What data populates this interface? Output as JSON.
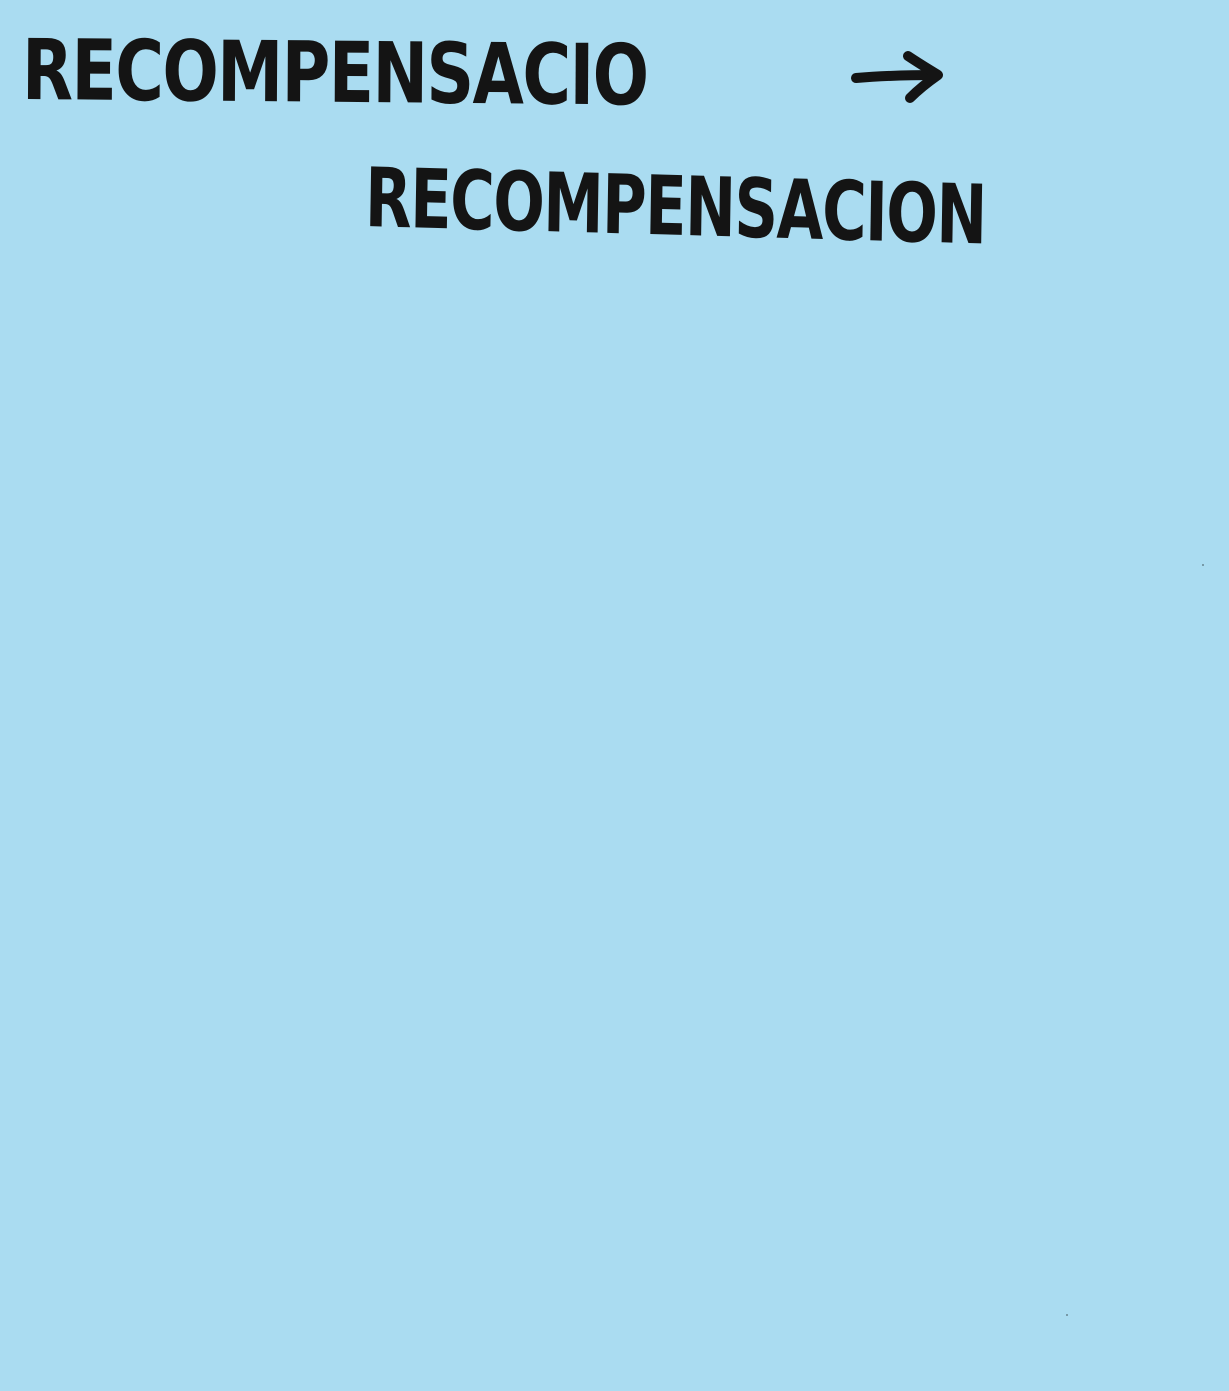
{
  "note": {
    "background_color": "#aadcf1",
    "ink_color": "#141414",
    "line_1": "RECOMPENSACIO",
    "arrow_icon": "right-arrow-icon",
    "line_2": "RECOMPENSACION"
  }
}
